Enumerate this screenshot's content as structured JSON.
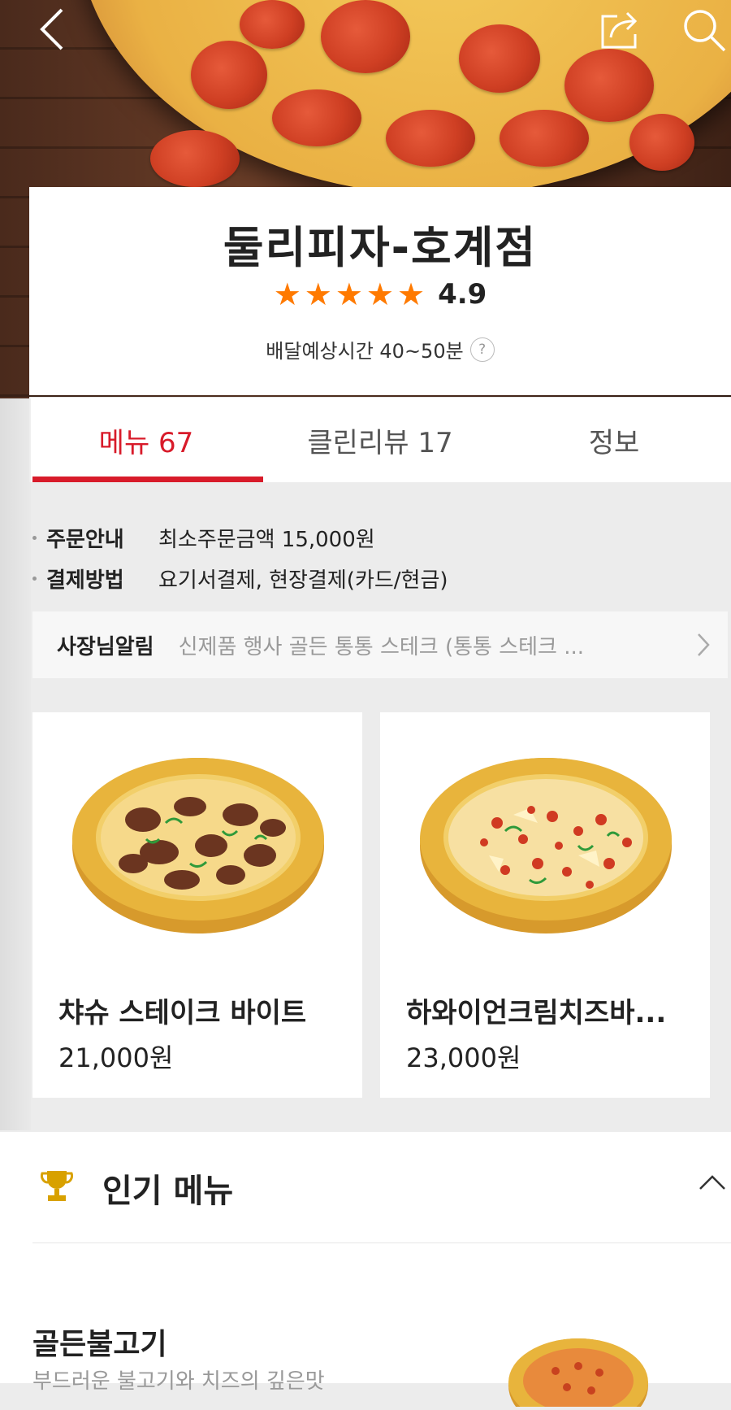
{
  "header": {
    "back_icon": "chevron-left-icon",
    "share_icon": "share-icon",
    "search_icon": "search-icon"
  },
  "store": {
    "name": "둘리피자-호계점",
    "stars": 5,
    "rating": "4.9",
    "delivery_time": "배달예상시간 40~50분",
    "help_icon": "?"
  },
  "tabs": [
    {
      "label": "메뉴 67",
      "active": true
    },
    {
      "label": "클린리뷰 17",
      "active": false
    },
    {
      "label": "정보",
      "active": false
    }
  ],
  "info": [
    {
      "key": "주문안내",
      "value": "최소주문금액 15,000원"
    },
    {
      "key": "결제방법",
      "value": "요기서결제, 현장결제(카드/현금)"
    }
  ],
  "notice": {
    "label": "사장님알림",
    "text": "신제품  행사 골든 통통 스테크 (통통 스테크  ..."
  },
  "featured": [
    {
      "name": "챠슈 스테이크 바이트",
      "price": "21,000원"
    },
    {
      "name": "하와이언크림치즈바...",
      "price": "23,000원"
    }
  ],
  "popular": {
    "title": "인기 메뉴",
    "items": [
      {
        "name": "골든불고기",
        "desc": "부드러운 불고기와 치즈의 깊은맛"
      }
    ]
  },
  "colors": {
    "accent": "#d81b2a",
    "star": "#ff7a00"
  }
}
